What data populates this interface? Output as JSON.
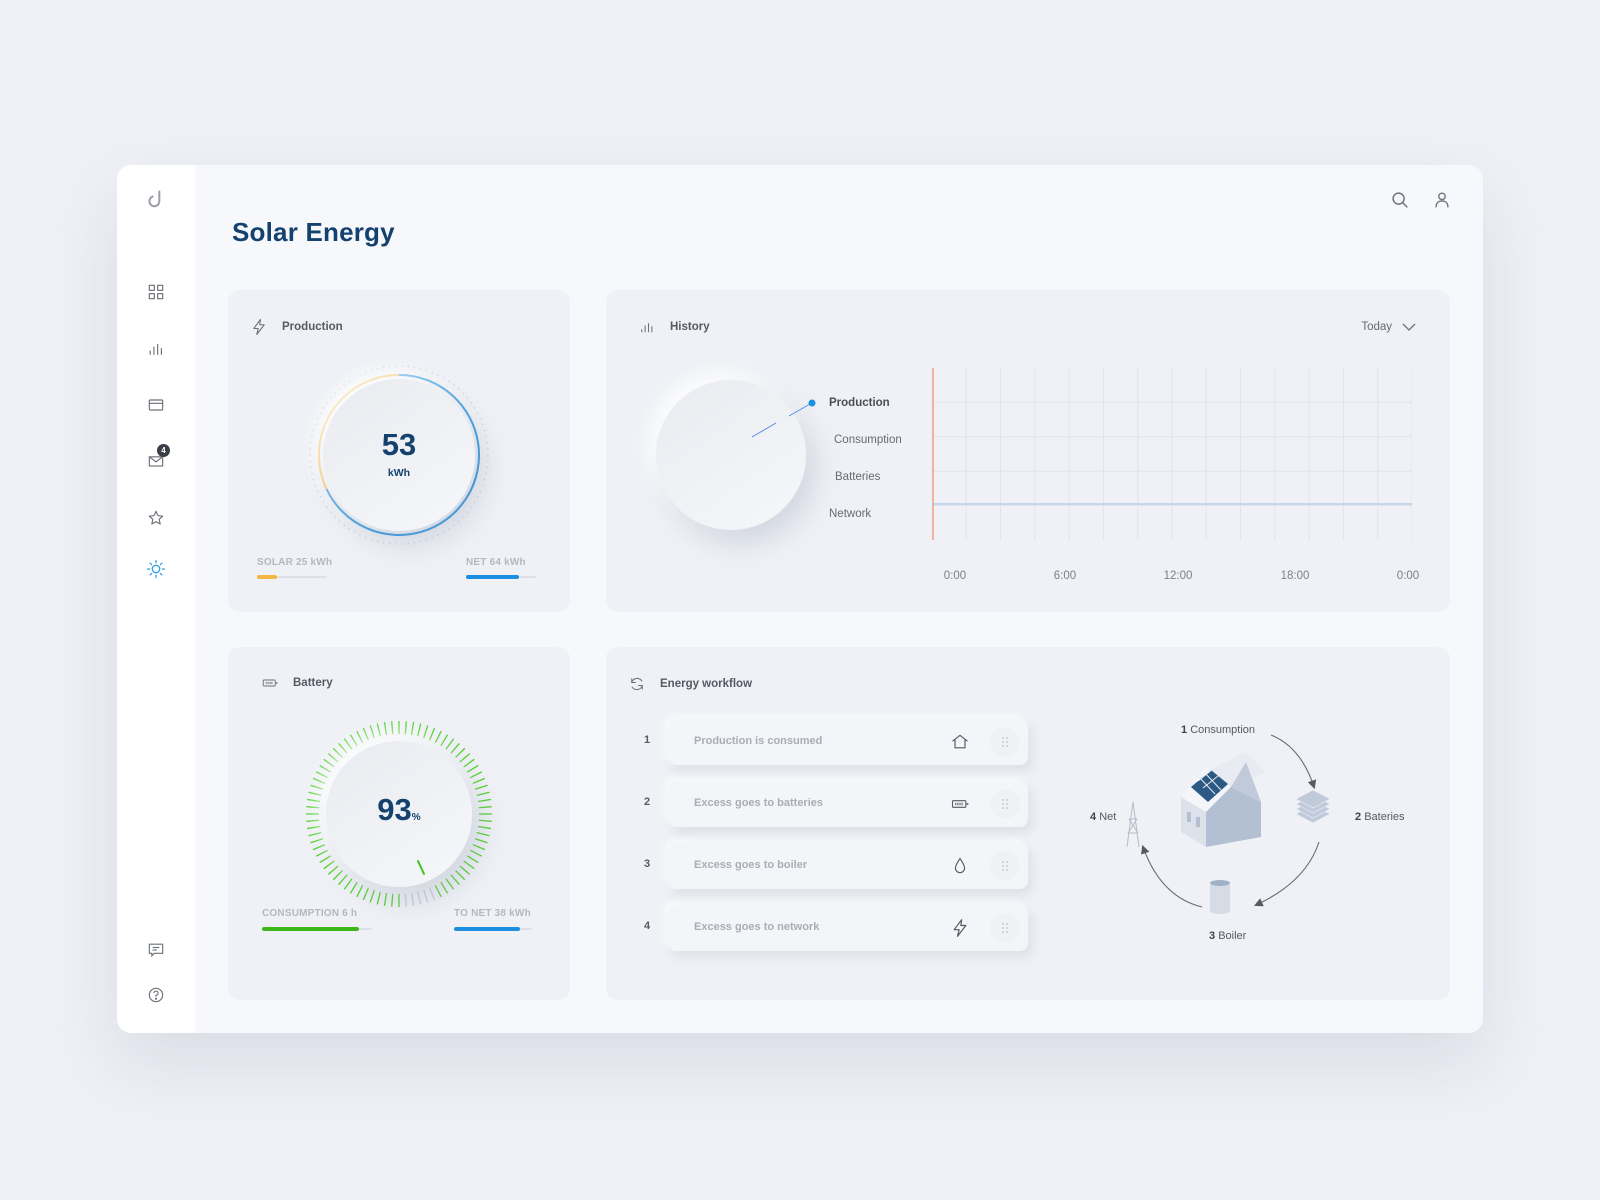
{
  "app": {
    "title": "Solar Energy",
    "logo": "crescent-logo-icon"
  },
  "sidebar": {
    "items": [
      {
        "icon": "dashboard-grid-icon",
        "label": "Dashboard",
        "active": false
      },
      {
        "icon": "bar-chart-icon",
        "label": "Statistics",
        "active": false
      },
      {
        "icon": "credit-card-icon",
        "label": "Payments",
        "active": false
      },
      {
        "icon": "mail-icon",
        "label": "Messages",
        "badge": "4",
        "active": false
      },
      {
        "icon": "star-icon",
        "label": "Favorites",
        "active": false
      },
      {
        "icon": "sun-icon",
        "label": "Solar Energy",
        "active": true
      }
    ],
    "bottom_items": [
      {
        "icon": "chat-icon",
        "label": "Chat"
      },
      {
        "icon": "help-icon",
        "label": "Help"
      }
    ]
  },
  "header": {
    "search_icon": "search-icon",
    "user_icon": "user-icon"
  },
  "colors": {
    "accent": "#14416e",
    "blue": "#1e8fe0",
    "orange": "#f5b642",
    "green": "#3cc41c",
    "active_icon": "#2b9be3"
  },
  "production": {
    "title": "Production",
    "value": "53",
    "unit": "kWh",
    "solar_fraction_of_ring": 0.32,
    "solar": {
      "label": "SOLAR 25 kWh",
      "progress": 0.28
    },
    "net": {
      "label": "NET 64 kWh",
      "progress": 0.76
    }
  },
  "history": {
    "title": "History",
    "range": "Today",
    "legend": [
      {
        "label": "Production",
        "active": true
      },
      {
        "label": "Consumption",
        "active": false
      },
      {
        "label": "Batteries",
        "active": false
      },
      {
        "label": "Network",
        "active": false
      }
    ],
    "x_ticks": [
      "0:00",
      "6:00",
      "12:00",
      "18:00",
      "0:00"
    ]
  },
  "battery": {
    "title": "Battery",
    "value": "93",
    "unit": "%",
    "level": 0.93,
    "consumption": {
      "label": "CONSUMPTION 6 h",
      "progress": 0.88
    },
    "to_net": {
      "label": "TO NET 38 kWh",
      "progress": 0.85
    }
  },
  "workflow": {
    "title": "Energy workflow",
    "steps": [
      {
        "num": "1",
        "text": "Production is consumed",
        "icon": "home-icon"
      },
      {
        "num": "2",
        "text": "Excess goes to batteries",
        "icon": "battery-icon"
      },
      {
        "num": "3",
        "text": "Excess goes to boiler",
        "icon": "water-drop-icon"
      },
      {
        "num": "4",
        "text": "Excess goes to network",
        "icon": "lightning-icon"
      }
    ],
    "diagram": {
      "consumption": {
        "num": "1",
        "label": "Consumption"
      },
      "batteries": {
        "num": "2",
        "label": "Bateries"
      },
      "boiler": {
        "num": "3",
        "label": "Boiler"
      },
      "net": {
        "num": "4",
        "label": "Net"
      }
    }
  }
}
